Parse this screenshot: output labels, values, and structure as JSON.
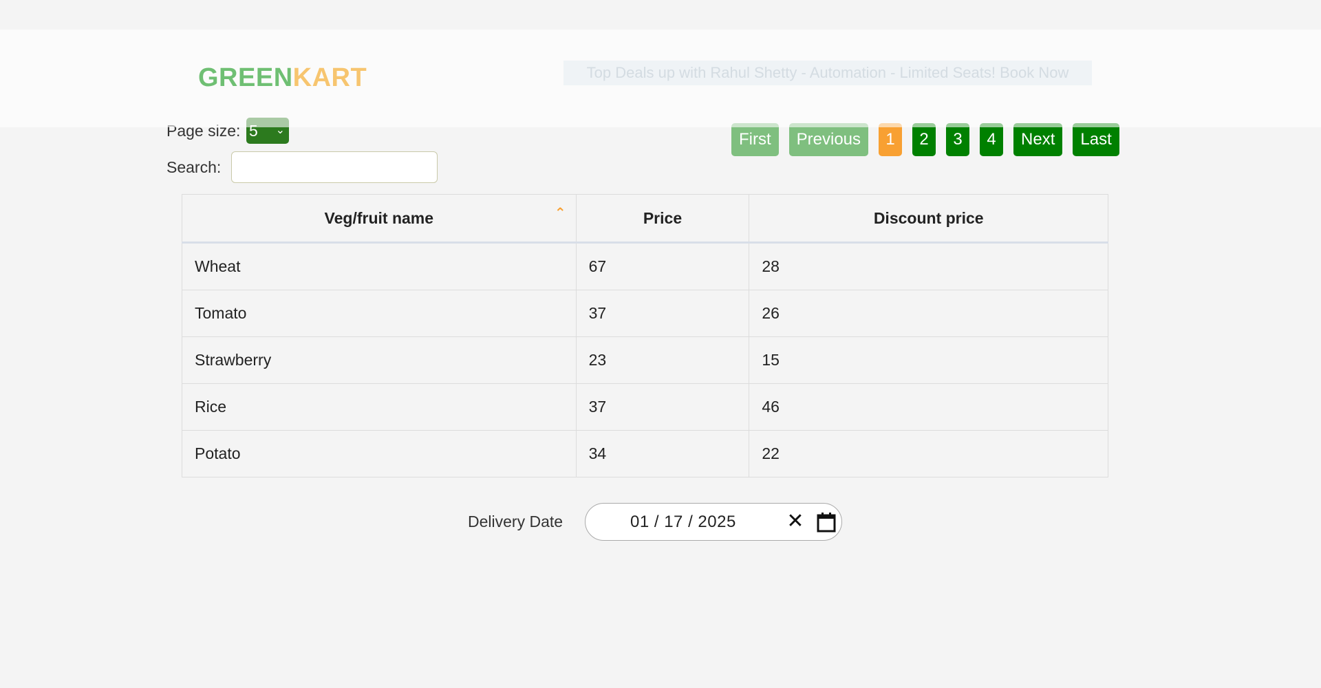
{
  "header": {
    "brand_green": "GREEN",
    "brand_kart": "KART",
    "top_link": "Top Deals up with Rahul Shetty - Automation - Limited Seats! Book Now"
  },
  "controls": {
    "page_size_label": "Page size:",
    "page_size_value": "5",
    "search_label": "Search:",
    "search_value": "",
    "search_placeholder": ""
  },
  "pagination": {
    "first": "First",
    "previous": "Previous",
    "pages": [
      "1",
      "2",
      "3",
      "4"
    ],
    "active_page": "1",
    "next": "Next",
    "last": "Last",
    "colors": {
      "enabled": "#008000",
      "disabled": "#7fbf7f",
      "active": "#f8a032"
    }
  },
  "table": {
    "headers": {
      "name": "Veg/fruit name",
      "price": "Price",
      "discount": "Discount price"
    },
    "sort_indicator": "ascending",
    "rows": [
      {
        "name": "Wheat",
        "price": "67",
        "discount": "28"
      },
      {
        "name": "Tomato",
        "price": "37",
        "discount": "26"
      },
      {
        "name": "Strawberry",
        "price": "23",
        "discount": "15"
      },
      {
        "name": "Rice",
        "price": "37",
        "discount": "46"
      },
      {
        "name": "Potato",
        "price": "34",
        "discount": "22"
      }
    ]
  },
  "delivery": {
    "label": "Delivery Date",
    "date_value": "01 / 17 / 2025"
  }
}
